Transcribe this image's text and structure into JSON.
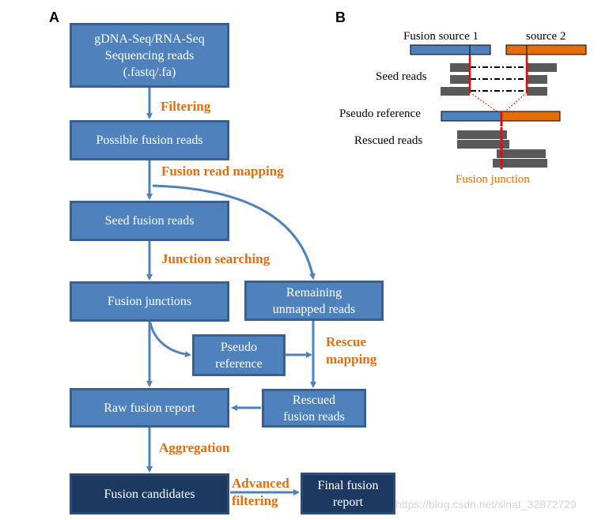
{
  "panels": {
    "a_label": "A",
    "b_label": "B"
  },
  "flowchart": {
    "boxes": {
      "input": [
        "gDNA-Seq/RNA-Seq",
        "Sequencing reads",
        "(.fastq/.fa)"
      ],
      "possible": "Possible fusion reads",
      "seed": "Seed fusion reads",
      "junctions": "Fusion junctions",
      "remaining": [
        "Remaining",
        "unmapped reads"
      ],
      "pseudo": [
        "Pseudo",
        "reference"
      ],
      "raw": "Raw fusion report",
      "rescued": [
        "Rescued",
        "fusion reads"
      ],
      "candidates": "Fusion candidates",
      "final": [
        "Final fusion",
        "report"
      ]
    },
    "steps": {
      "filtering": "Filtering",
      "mapping": "Fusion read mapping",
      "searching": "Junction searching",
      "rescue": [
        "Rescue",
        "mapping"
      ],
      "aggregation": "Aggregation",
      "advanced": [
        "Advanced",
        "filtering"
      ]
    }
  },
  "schematic": {
    "source1": "Fusion source 1",
    "source2": "source 2",
    "seed_reads": "Seed reads",
    "pseudo_reference": "Pseudo reference",
    "rescued_reads": "Rescued reads",
    "fusion_junction": "Fusion junction"
  },
  "colors": {
    "box_fill": "#4f81bd",
    "box_dark_fill": "#1c3962",
    "step_text": "#e46c0a",
    "source1": "#4f81bd",
    "source2": "#e46c0a",
    "read": "#595959",
    "junction": "#ff0000"
  },
  "watermark": "https://blog.csdn.net/sinat_32872729"
}
